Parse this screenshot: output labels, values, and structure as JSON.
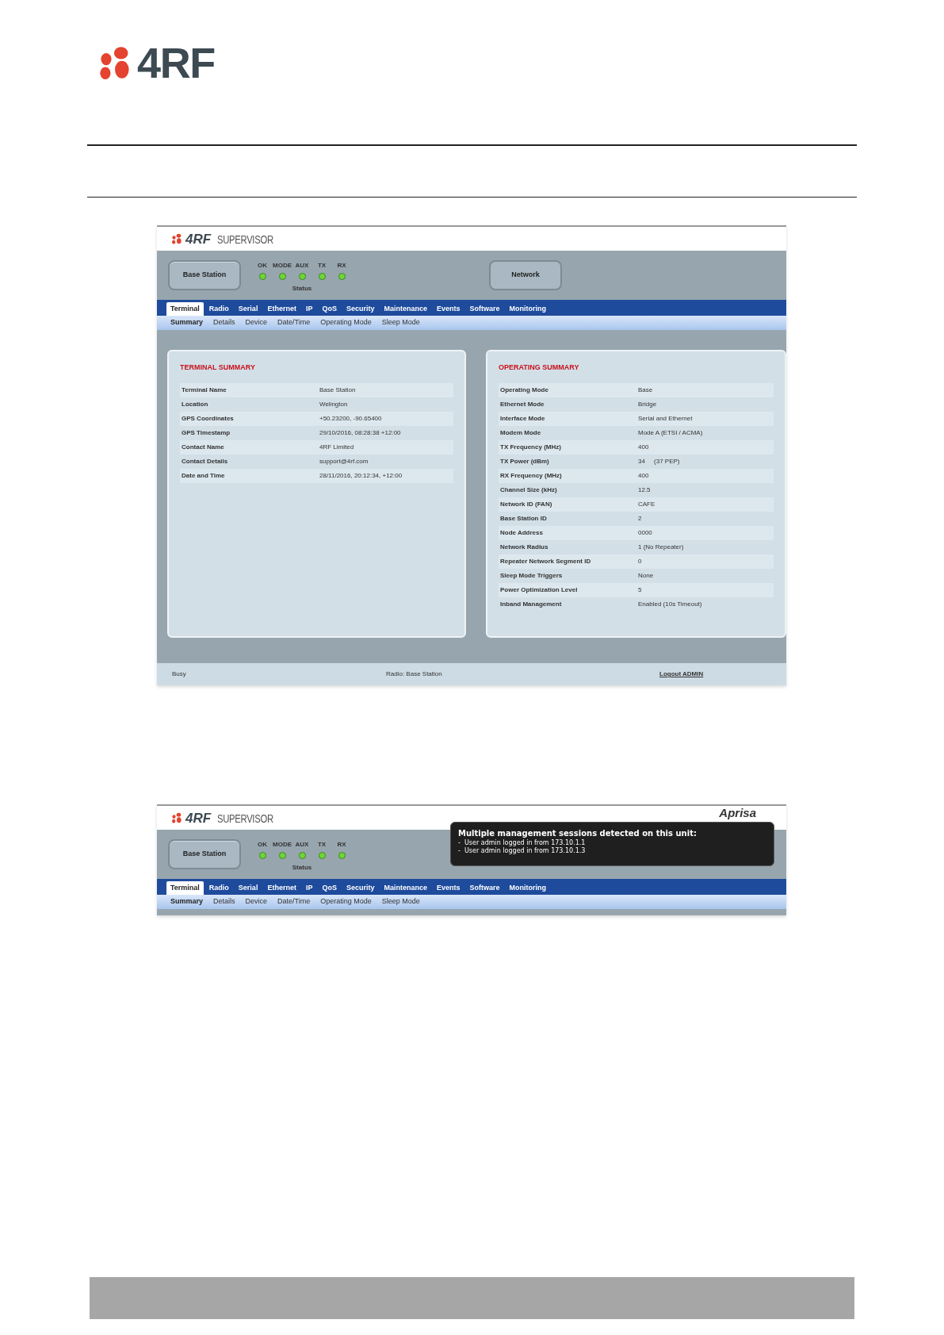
{
  "page_logo": "4RF",
  "screenshots": [
    {
      "logo": "4RF",
      "product": "SUPERVISOR",
      "device_button": "Base Station",
      "leds": [
        {
          "label": "OK",
          "on": true
        },
        {
          "label": "MODE",
          "on": true
        },
        {
          "label": "AUX",
          "on": true
        },
        {
          "label": "TX",
          "on": true
        },
        {
          "label": "RX",
          "on": true
        }
      ],
      "status_label": "Status",
      "network_button": "Network",
      "tabs": [
        {
          "label": "Terminal",
          "selected": true
        },
        {
          "label": "Radio",
          "selected": false
        },
        {
          "label": "Serial",
          "selected": false
        },
        {
          "label": "Ethernet",
          "selected": false
        },
        {
          "label": "IP",
          "selected": false
        },
        {
          "label": "QoS",
          "selected": false
        },
        {
          "label": "Security",
          "selected": false
        },
        {
          "label": "Maintenance",
          "selected": false
        },
        {
          "label": "Events",
          "selected": false
        },
        {
          "label": "Software",
          "selected": false
        },
        {
          "label": "Monitoring",
          "selected": false
        }
      ],
      "subtabs": [
        {
          "label": "Summary",
          "selected": true
        },
        {
          "label": "Details",
          "selected": false
        },
        {
          "label": "Device",
          "selected": false
        },
        {
          "label": "Date/Time",
          "selected": false
        },
        {
          "label": "Operating Mode",
          "selected": false
        },
        {
          "label": "Sleep Mode",
          "selected": false
        }
      ],
      "panels": [
        {
          "title": "TERMINAL SUMMARY",
          "rows": [
            [
              "Terminal Name",
              "Base Station"
            ],
            [
              "Location",
              "Welington"
            ],
            [
              "GPS Coordinates",
              "+50.23200, -90.65400"
            ],
            [
              "GPS Timestamp",
              "29/10/2016, 08:28:38 +12:00"
            ],
            [
              "Contact Name",
              "4RF Limited"
            ],
            [
              "Contact Details",
              "support@4rf.com"
            ],
            [
              "Date and Time",
              "28/11/2016, 20:12:34, +12:00"
            ]
          ]
        },
        {
          "title": "OPERATING SUMMARY",
          "rows": [
            [
              "Operating Mode",
              "Base"
            ],
            [
              "Ethernet Mode",
              "Bridge"
            ],
            [
              "Interface Mode",
              "Serial and Ethernet"
            ],
            [
              "Modem Mode",
              "Mode A (ETSI / ACMA)"
            ],
            [
              "TX Frequency (MHz)",
              "400"
            ],
            [
              "TX Power (dBm)",
              "34     (37 PEP)"
            ],
            [
              "RX Frequency (MHz)",
              "400"
            ],
            [
              "Channel Size (kHz)",
              "12.5"
            ],
            [
              "Network ID (FAN)",
              "CAFE"
            ],
            [
              "Base Station ID",
              "2"
            ],
            [
              "Node Address",
              "0000"
            ],
            [
              "Network Radius",
              "1 (No Repeater)"
            ],
            [
              "Repeater Network Segment ID",
              "0"
            ],
            [
              "Sleep Mode Triggers",
              "None"
            ],
            [
              "Power Optimization Level",
              "5"
            ],
            [
              "Inband Management",
              "Enabled (10s Timeout)"
            ]
          ]
        }
      ],
      "status_bar": {
        "left": "Busy",
        "center": "Radio: Base Station",
        "link": "Logout ADMIN"
      }
    },
    {
      "logo": "4RF",
      "product": "SUPERVISOR",
      "brand": "Aprisa",
      "device_button": "Base Station",
      "leds": [
        {
          "label": "OK",
          "on": true
        },
        {
          "label": "MODE",
          "on": true
        },
        {
          "label": "AUX",
          "on": true
        },
        {
          "label": "TX",
          "on": true
        },
        {
          "label": "RX",
          "on": true
        }
      ],
      "status_label": "Status",
      "popup": {
        "title": "Multiple management sessions detected on this unit:",
        "lines": [
          "-  User admin logged in from 173.10.1.1",
          "-  User admin logged in from 173.10.1.3"
        ]
      },
      "tabs": [
        {
          "label": "Terminal",
          "selected": true
        },
        {
          "label": "Radio",
          "selected": false
        },
        {
          "label": "Serial",
          "selected": false
        },
        {
          "label": "Ethernet",
          "selected": false
        },
        {
          "label": "IP",
          "selected": false
        },
        {
          "label": "QoS",
          "selected": false
        },
        {
          "label": "Security",
          "selected": false
        },
        {
          "label": "Maintenance",
          "selected": false
        },
        {
          "label": "Events",
          "selected": false
        },
        {
          "label": "Software",
          "selected": false
        },
        {
          "label": "Monitoring",
          "selected": false
        }
      ],
      "subtabs": [
        {
          "label": "Summary",
          "selected": true
        },
        {
          "label": "Details",
          "selected": false
        },
        {
          "label": "Device",
          "selected": false
        },
        {
          "label": "Date/Time",
          "selected": false
        },
        {
          "label": "Operating Mode",
          "selected": false
        },
        {
          "label": "Sleep Mode",
          "selected": false
        }
      ]
    }
  ]
}
